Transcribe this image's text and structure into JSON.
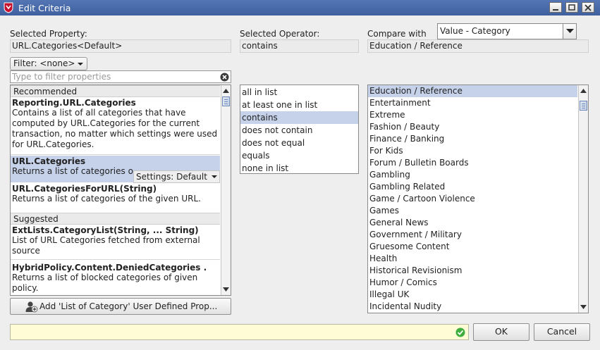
{
  "window": {
    "title": "Edit Criteria"
  },
  "labels": {
    "selected_property": "Selected Property:",
    "selected_operator": "Selected Operator:",
    "compare_with": "Compare with"
  },
  "selected_property_value": "URL.Categories<Default>",
  "selected_operator_value": "contains",
  "compare_value": "Education / Reference",
  "compare_combo": "Value - Category",
  "filter": {
    "label": "Filter: <none>",
    "placeholder": "Type to filter properties"
  },
  "properties": {
    "recommended_header": "Recommended",
    "suggested_header": "Suggested",
    "recommended": [
      {
        "name": "Reporting.URL.Categories",
        "desc": [
          "Contains a list of all categories that have",
          "computed by URL.Categories for the current",
          "transaction, no matter which settings were used",
          "for URL.Categories."
        ]
      },
      {
        "name": "URL.Categories",
        "desc": [
          "Returns a list of categories o"
        ]
      },
      {
        "name": "URL.CategoriesForURL(String)",
        "desc": [
          "Returns a list of categories of the given URL."
        ]
      }
    ],
    "suggested": [
      {
        "name": "ExtLists.CategoryList(String, ... String)",
        "desc": [
          "List of URL Categories fetched from external",
          "source"
        ]
      },
      {
        "name": "HybridPolicy.Content.DeniedCategories .",
        "desc": [
          "Returns a list of blocked categories of given",
          "policy."
        ]
      }
    ],
    "settings_popup": "Settings: Default"
  },
  "operators": [
    "all in list",
    "at least one in list",
    "contains",
    "does not contain",
    "does not equal",
    "equals",
    "none in list"
  ],
  "categories": [
    "Education / Reference",
    "Entertainment",
    "Extreme",
    "Fashion / Beauty",
    "Finance / Banking",
    "For Kids",
    "Forum / Bulletin Boards",
    "Gambling",
    "Gambling Related",
    "Game / Cartoon Violence",
    "Games",
    "General News",
    "Government / Military",
    "Gruesome Content",
    "Health",
    "Historical Revisionism",
    "Humor / Comics",
    "Illegal UK",
    "Incidental Nudity"
  ],
  "add_button": "Add 'List of Category' User Defined Prop...",
  "buttons": {
    "ok": "OK",
    "cancel": "Cancel"
  },
  "colors": {
    "titlebar": "#4a6aaa",
    "selection": "#c5d2ea",
    "status_bg": "#fffcd6",
    "ok_icon": "#3fae3f"
  }
}
